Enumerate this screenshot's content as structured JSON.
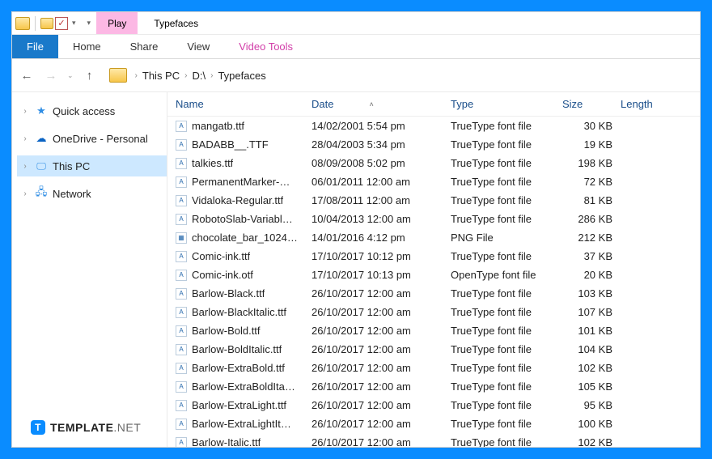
{
  "title": "Typefaces",
  "toolTab": "Play",
  "toolTabGroup": "Video Tools",
  "ribbon": {
    "file": "File",
    "home": "Home",
    "share": "Share",
    "view": "View",
    "videoTools": "Video Tools"
  },
  "breadcrumbs": [
    "This PC",
    "D:\\",
    "Typefaces"
  ],
  "sidebar": {
    "quickAccess": "Quick access",
    "onedrive": "OneDrive - Personal",
    "thisPC": "This PC",
    "network": "Network"
  },
  "columns": {
    "name": "Name",
    "date": "Date",
    "type": "Type",
    "size": "Size",
    "length": "Length"
  },
  "files": [
    {
      "name": "mangatb.ttf",
      "date": "14/02/2001 5:54 pm",
      "type": "TrueType font file",
      "size": "30 KB",
      "icon": "A"
    },
    {
      "name": "BADABB__.TTF",
      "date": "28/04/2003 5:34 pm",
      "type": "TrueType font file",
      "size": "19 KB",
      "icon": "A"
    },
    {
      "name": "talkies.ttf",
      "date": "08/09/2008 5:02 pm",
      "type": "TrueType font file",
      "size": "198 KB",
      "icon": "A"
    },
    {
      "name": "PermanentMarker-…",
      "date": "06/01/2011 12:00 am",
      "type": "TrueType font file",
      "size": "72 KB",
      "icon": "A"
    },
    {
      "name": "Vidaloka-Regular.ttf",
      "date": "17/08/2011 12:00 am",
      "type": "TrueType font file",
      "size": "81 KB",
      "icon": "A"
    },
    {
      "name": "RobotoSlab-Variabl…",
      "date": "10/04/2013 12:00 am",
      "type": "TrueType font file",
      "size": "286 KB",
      "icon": "A"
    },
    {
      "name": "chocolate_bar_1024…",
      "date": "14/01/2016 4:12 pm",
      "type": "PNG File",
      "size": "212 KB",
      "icon": "▦"
    },
    {
      "name": "Comic-ink.ttf",
      "date": "17/10/2017 10:12 pm",
      "type": "TrueType font file",
      "size": "37 KB",
      "icon": "A"
    },
    {
      "name": "Comic-ink.otf",
      "date": "17/10/2017 10:13 pm",
      "type": "OpenType font file",
      "size": "20 KB",
      "icon": "A"
    },
    {
      "name": "Barlow-Black.ttf",
      "date": "26/10/2017 12:00 am",
      "type": "TrueType font file",
      "size": "103 KB",
      "icon": "A"
    },
    {
      "name": "Barlow-BlackItalic.ttf",
      "date": "26/10/2017 12:00 am",
      "type": "TrueType font file",
      "size": "107 KB",
      "icon": "A"
    },
    {
      "name": "Barlow-Bold.ttf",
      "date": "26/10/2017 12:00 am",
      "type": "TrueType font file",
      "size": "101 KB",
      "icon": "A"
    },
    {
      "name": "Barlow-BoldItalic.ttf",
      "date": "26/10/2017 12:00 am",
      "type": "TrueType font file",
      "size": "104 KB",
      "icon": "A"
    },
    {
      "name": "Barlow-ExtraBold.ttf",
      "date": "26/10/2017 12:00 am",
      "type": "TrueType font file",
      "size": "102 KB",
      "icon": "A"
    },
    {
      "name": "Barlow-ExtraBoldIta…",
      "date": "26/10/2017 12:00 am",
      "type": "TrueType font file",
      "size": "105 KB",
      "icon": "A"
    },
    {
      "name": "Barlow-ExtraLight.ttf",
      "date": "26/10/2017 12:00 am",
      "type": "TrueType font file",
      "size": "95 KB",
      "icon": "A"
    },
    {
      "name": "Barlow-ExtraLightIt…",
      "date": "26/10/2017 12:00 am",
      "type": "TrueType font file",
      "size": "100 KB",
      "icon": "A"
    },
    {
      "name": "Barlow-Italic.ttf",
      "date": "26/10/2017 12:00 am",
      "type": "TrueType font file",
      "size": "102 KB",
      "icon": "A"
    }
  ],
  "brand": {
    "main": "TEMPLATE",
    "suffix": ".NET"
  }
}
